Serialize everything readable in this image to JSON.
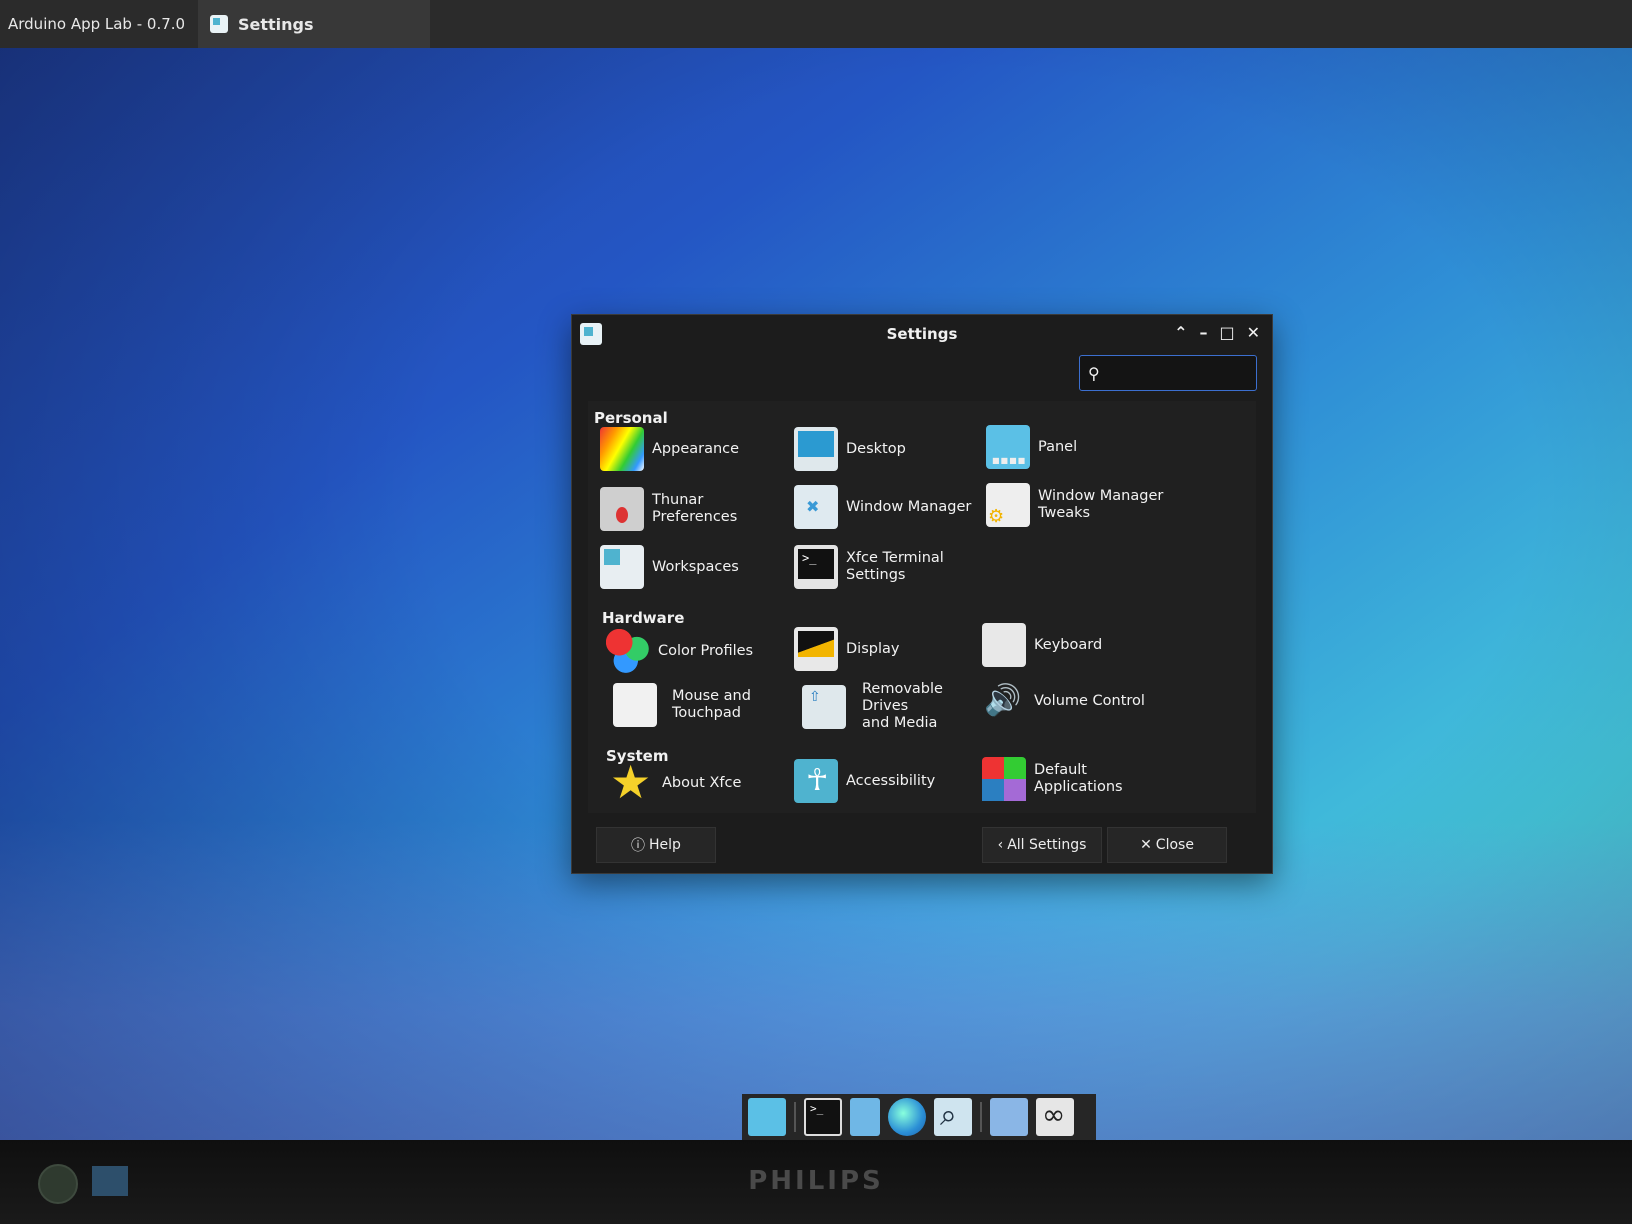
{
  "top_panel": {
    "app_title": "Arduino App Lab - 0.7.0",
    "task_label": "Settings"
  },
  "window": {
    "title": "Settings",
    "search": {
      "value": "",
      "placeholder": ""
    },
    "categories": {
      "personal": "Personal",
      "hardware": "Hardware",
      "system": "System"
    },
    "items": {
      "appearance": "Appearance",
      "desktop": "Desktop",
      "panel": "Panel",
      "thunar": "Thunar Preferences",
      "wm": "Window Manager",
      "wmt_1": "Window Manager",
      "wmt_2": "Tweaks",
      "workspaces": "Workspaces",
      "terminal_1": "Xfce Terminal",
      "terminal_2": "Settings",
      "color": "Color Profiles",
      "display": "Display",
      "keyboard": "Keyboard",
      "mouse_1": "Mouse and",
      "mouse_2": "Touchpad",
      "drives_1": "Removable Drives",
      "drives_2": "and Media",
      "volume": "Volume Control",
      "about": "About Xfce",
      "accessibility": "Accessibility",
      "default_1": "Default",
      "default_2": "Applications"
    },
    "buttons": {
      "help": "Help",
      "all_settings": "All Settings",
      "close": "Close"
    }
  },
  "monitor": {
    "brand": "PHILIPS"
  },
  "colors": {
    "search_border": "#3c6fcf",
    "window_bg": "#1c1c1c",
    "accent": "#4fb3cf"
  }
}
